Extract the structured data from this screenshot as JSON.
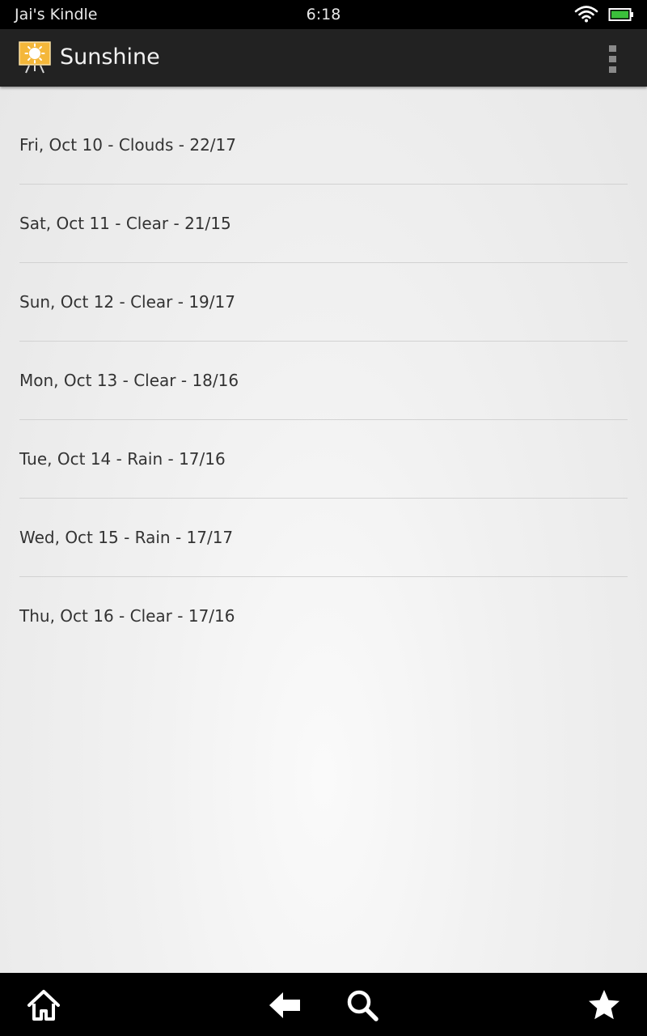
{
  "status_bar": {
    "device_name": "Jai's Kindle",
    "time": "6:18",
    "wifi_icon": "wifi-icon",
    "battery_icon": "battery-icon",
    "battery_color": "#3bbf3b"
  },
  "action_bar": {
    "app_icon": "sun-icon",
    "title": "Sunshine",
    "overflow_icon": "overflow-menu-icon"
  },
  "forecast": [
    {
      "label": "Fri, Oct 10 - Clouds - 22/17"
    },
    {
      "label": "Sat, Oct 11 - Clear - 21/15"
    },
    {
      "label": "Sun, Oct 12 - Clear - 19/17"
    },
    {
      "label": "Mon, Oct 13 - Clear - 18/16"
    },
    {
      "label": "Tue, Oct 14 - Rain - 17/16"
    },
    {
      "label": "Wed, Oct 15 - Rain - 17/17"
    },
    {
      "label": "Thu, Oct 16 - Clear - 17/16"
    }
  ],
  "nav_bar": {
    "home_icon": "home-icon",
    "back_icon": "back-arrow-icon",
    "search_icon": "search-icon",
    "favorites_icon": "star-icon"
  }
}
